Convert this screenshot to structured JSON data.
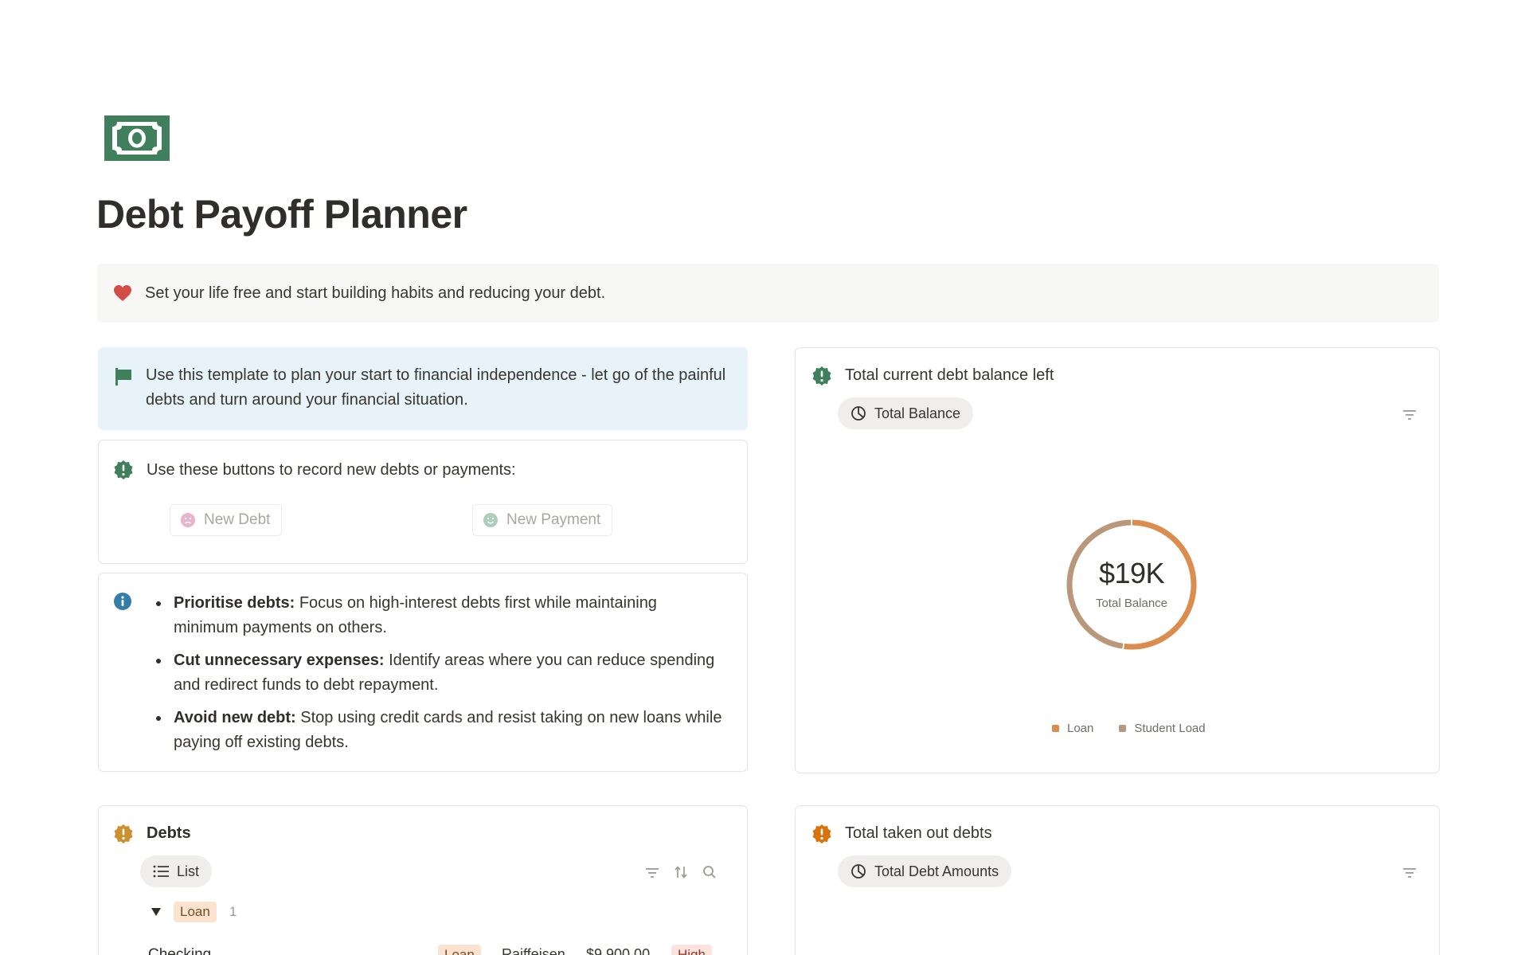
{
  "page": {
    "title": "Debt Payoff Planner",
    "icon": "money-bill-icon",
    "banner": {
      "icon": "heart-icon",
      "text": "Set your life free and start building habits and reducing your debt."
    }
  },
  "colors": {
    "green": "#3f7f5c",
    "blue_callout": "#e7f3f8",
    "info_blue": "#337ea9",
    "orange": "#d9730d",
    "heart_red": "#d44c47",
    "loan_color": "#dc8c4c",
    "student_color": "#b8977a"
  },
  "intro_callout": {
    "icon": "flag-icon",
    "text": "Use this template to plan your start to financial independence - let go of the painful debts and turn around your financial situation."
  },
  "buttons_callout": {
    "icon": "alert-badge-icon",
    "text": "Use these buttons to record new debts or payments:",
    "new_debt": {
      "label": "New Debt",
      "icon": "sad-face-icon"
    },
    "new_payment": {
      "label": "New Payment",
      "icon": "smile-face-icon"
    }
  },
  "tips": {
    "icon": "info-icon",
    "items": [
      {
        "bold": "Prioritise debts:",
        "text": " Focus on high-interest debts first while maintaining minimum payments on others."
      },
      {
        "bold": "Cut unnecessary expenses:",
        "text": " Identify areas where you can reduce spending and redirect funds to debt repayment."
      },
      {
        "bold": "Avoid new debt:",
        "text": " Stop using credit cards and resist taking on new loans while paying off existing debts."
      }
    ]
  },
  "balance_card": {
    "title": "Total current debt balance left",
    "view_label": "Total Balance",
    "chart_data": {
      "type": "pie",
      "center_value": "$19K",
      "center_label": "Total Balance",
      "categories": [
        "Loan",
        "Student Load"
      ],
      "values": [
        9900,
        9100
      ],
      "legend": "bottom"
    }
  },
  "debts_card": {
    "title": "Debts",
    "view_label": "List",
    "group": {
      "label": "Loan",
      "count": "1"
    },
    "row": {
      "name": "Checking",
      "type": "Loan",
      "bank": "Raiffeisen",
      "amount": "$9,900.00",
      "priority": "High"
    }
  },
  "taken_card": {
    "title": "Total taken out debts",
    "view_label": "Total Debt Amounts"
  }
}
